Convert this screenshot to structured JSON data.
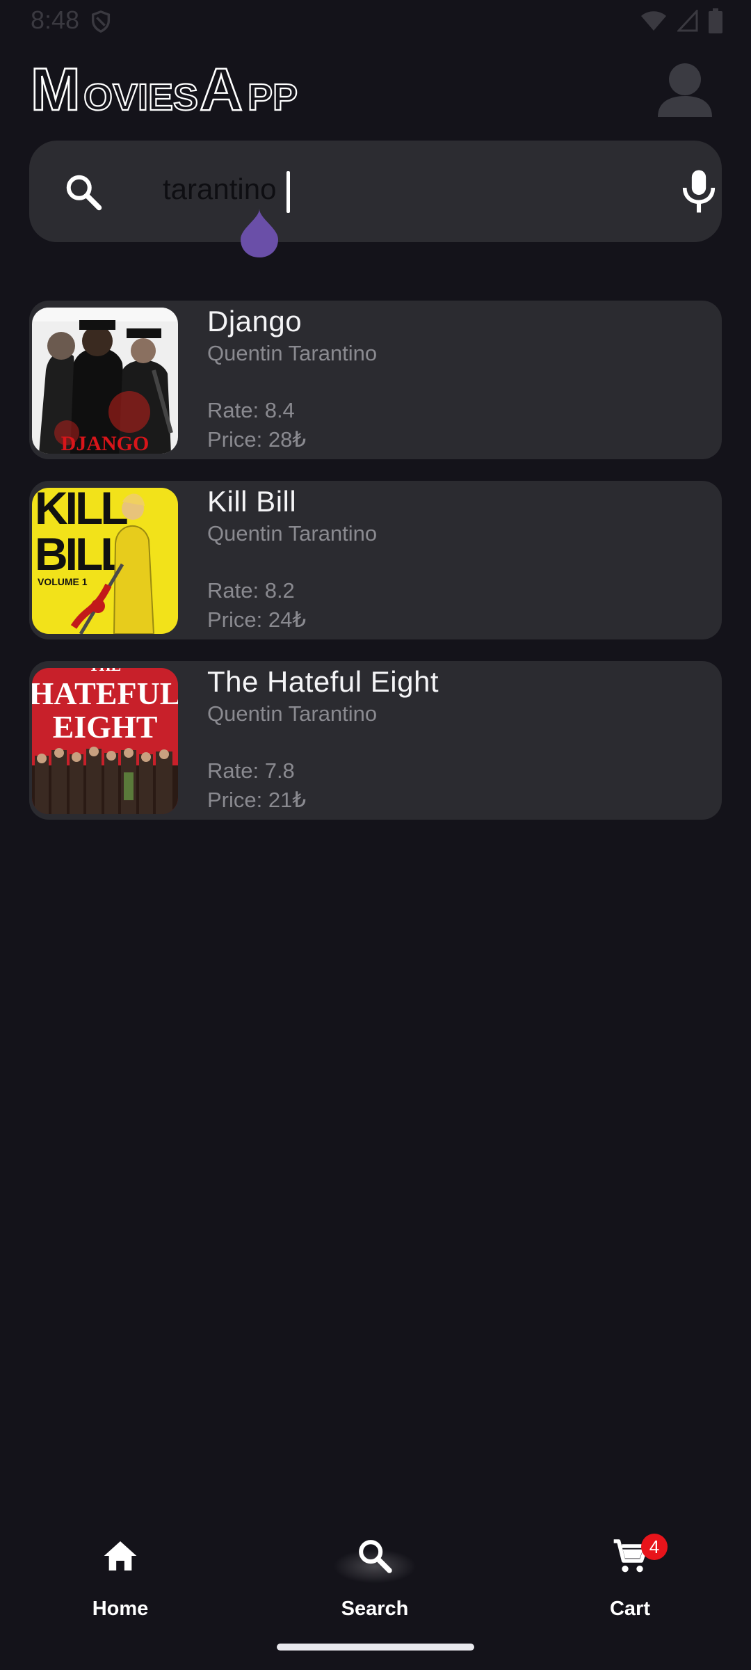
{
  "status_bar": {
    "time": "8:48"
  },
  "app": {
    "logo_text": "MoviesApp"
  },
  "search": {
    "value": "tarantino",
    "accent_color": "#6a4fa8"
  },
  "movies": [
    {
      "title": "Django",
      "director": "Quentin Tarantino",
      "rate": "Rate: 8.4",
      "price": "Price: 28₺",
      "poster": "django-poster"
    },
    {
      "title": "Kill Bill",
      "director": "Quentin Tarantino",
      "rate": "Rate: 8.2",
      "price": "Price: 24₺",
      "poster": "kill-bill-poster"
    },
    {
      "title": "The Hateful Eight",
      "director": "Quentin Tarantino",
      "rate": "Rate: 7.8",
      "price": "Price: 21₺",
      "poster": "hateful-eight-poster"
    }
  ],
  "bottom_nav": {
    "items": [
      {
        "label": "Home",
        "icon": "home-icon"
      },
      {
        "label": "Search",
        "icon": "search-icon",
        "selected": true
      },
      {
        "label": "Cart",
        "icon": "cart-icon",
        "badge": "4"
      }
    ]
  },
  "posters": {
    "django": {
      "lettering": "DJANGO"
    },
    "kill_bill": {
      "lettering": [
        "KILL",
        "BILL",
        "VOLUME 1"
      ]
    },
    "hateful_eight": {
      "lettering": [
        "THE",
        "HATEFUL",
        "EIGHT"
      ]
    }
  }
}
